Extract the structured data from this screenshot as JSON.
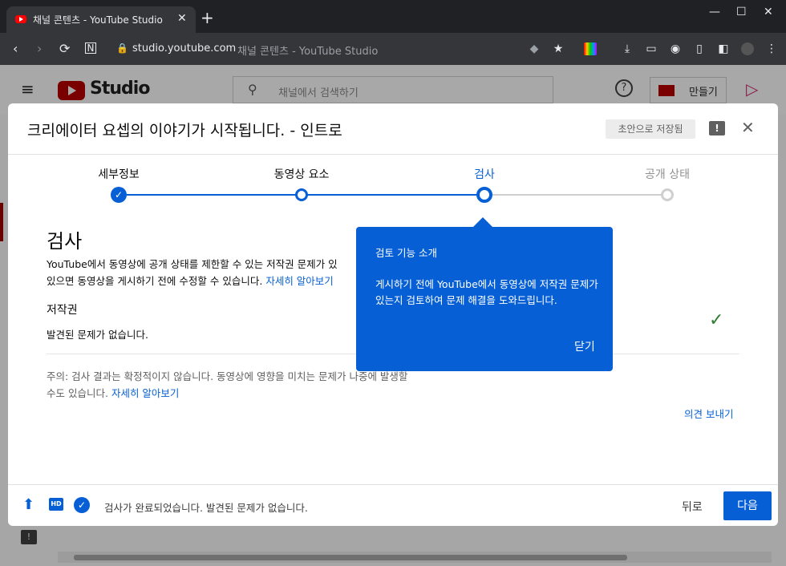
{
  "browser": {
    "tab_title": "채널 콘텐츠 - YouTube Studio",
    "url_host": "studio.youtube.com",
    "url_page_title": "채널 콘텐츠 - YouTube Studio"
  },
  "studio": {
    "logo_text": "Studio",
    "search_placeholder": "채널에서 검색하기",
    "create_label": "만들기"
  },
  "dialog": {
    "title": "크리에이터 요셉의 이야기가 시작됩니다. - 인트로",
    "draft_badge": "초안으로 저장됨",
    "steps": [
      {
        "label": "세부정보",
        "state": "done"
      },
      {
        "label": "동영상 요소",
        "state": "done"
      },
      {
        "label": "검사",
        "state": "current"
      },
      {
        "label": "공개 상태",
        "state": "todo"
      }
    ],
    "section_title": "검사",
    "intro_line1": "YouTube에서 동영상에 공개 상태를 제한할 수 있는 저작권 문제가 있",
    "intro_line2": "있으면 동영상을 게시하기 전에 수정할 수 있습니다.",
    "learn_more": "자세히 알아보기",
    "copyright_title": "저작권",
    "copyright_status": "발견된 문제가 없습니다.",
    "note_line1": "주의: 검사 결과는 확정적이지 않습니다. 동영상에 영향을 미치는 문제가 나중에 발생할",
    "note_line2": "수도 있습니다.",
    "note_link": "자세히 알아보기",
    "feedback_link": "의견 보내기",
    "footer_status": "검사가 완료되었습니다. 발견된 문제가 없습니다.",
    "back_label": "뒤로",
    "next_label": "다음"
  },
  "tooltip": {
    "title": "검토 기능 소개",
    "body": "게시하기 전에 YouTube에서 동영상에 저작권 문제가 있는지 검토하여 문제 해결을 도와드립니다.",
    "close_label": "닫기"
  },
  "colors": {
    "accent": "#065fd4",
    "check_green": "#2e7d32"
  }
}
